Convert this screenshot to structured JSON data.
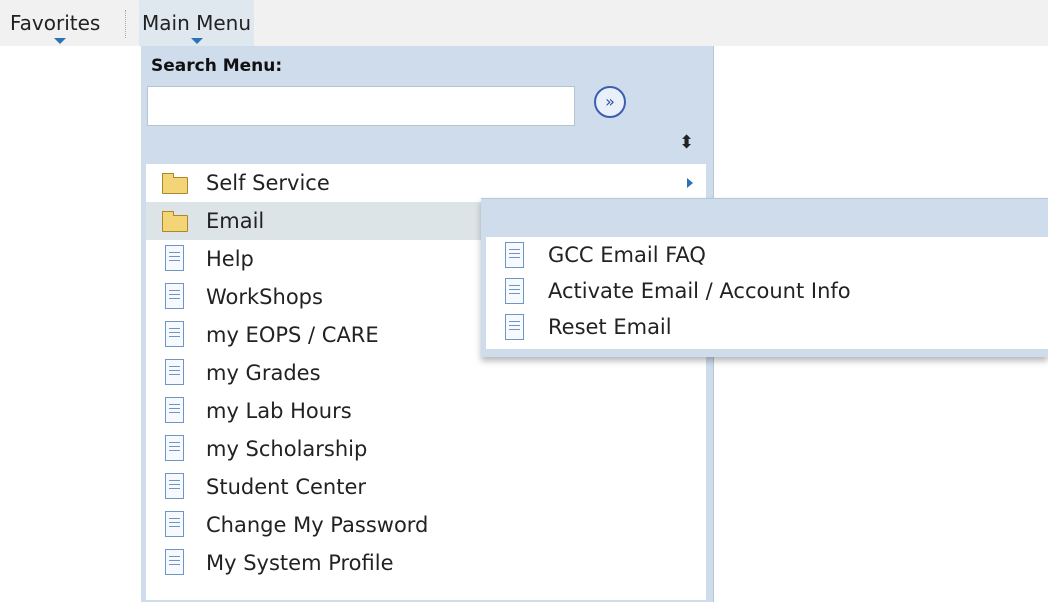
{
  "nav": {
    "favorites_label": "Favorites",
    "main_menu_label": "Main Menu"
  },
  "search": {
    "label": "Search Menu:",
    "value": "",
    "placeholder": "",
    "go_glyph": "»"
  },
  "sort_glyph": "⬍",
  "menu": {
    "items": [
      {
        "label": "Self Service",
        "icon": "folder-icon",
        "has_submenu": true
      },
      {
        "label": "Email",
        "icon": "folder-icon",
        "active": true
      },
      {
        "label": "Help",
        "icon": "document-icon"
      },
      {
        "label": "WorkShops",
        "icon": "document-icon"
      },
      {
        "label": "my EOPS / CARE",
        "icon": "document-icon"
      },
      {
        "label": "my Grades",
        "icon": "document-icon"
      },
      {
        "label": "my Lab Hours",
        "icon": "document-icon"
      },
      {
        "label": "my Scholarship",
        "icon": "document-icon"
      },
      {
        "label": "Student Center",
        "icon": "document-icon"
      },
      {
        "label": "Change My Password",
        "icon": "document-icon"
      },
      {
        "label": "My System Profile",
        "icon": "document-icon"
      }
    ]
  },
  "flyout": {
    "items": [
      {
        "label": "GCC Email FAQ",
        "icon": "document-icon"
      },
      {
        "label": "Activate Email / Account Info",
        "icon": "document-icon"
      },
      {
        "label": "Reset Email",
        "icon": "document-icon"
      }
    ]
  },
  "colors": {
    "panel": "#cfdcec",
    "highlight": "#dde4e8",
    "accent": "#2a73b8",
    "folder": "#f3d477"
  }
}
